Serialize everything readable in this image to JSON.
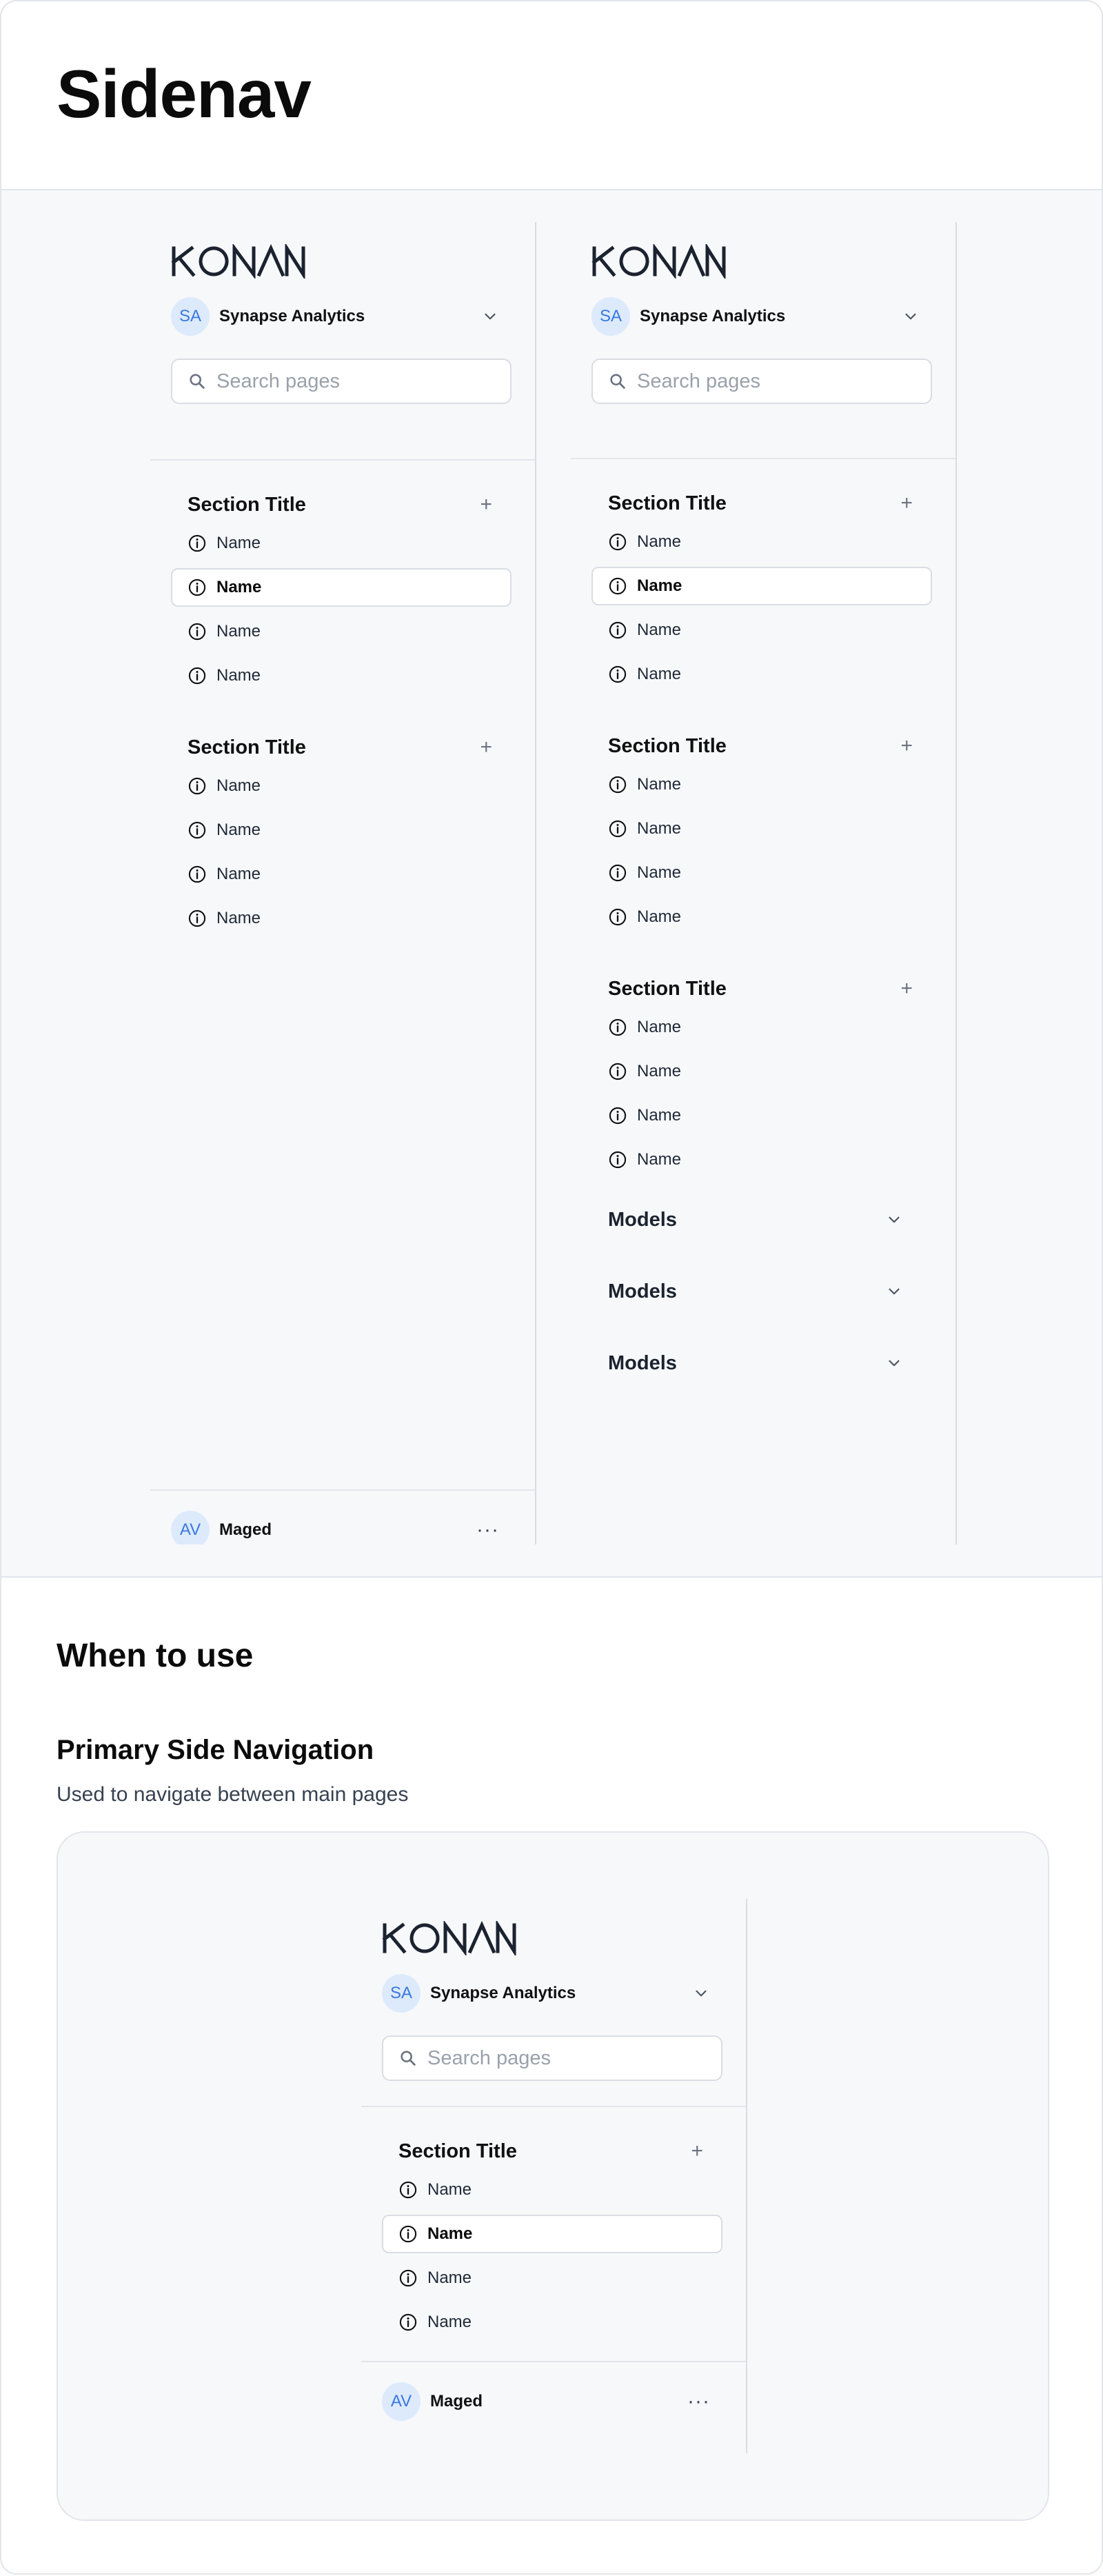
{
  "page": {
    "title": "Sidenav"
  },
  "brand": {
    "logo_text": "KONAN",
    "logo_color": "#1b2330"
  },
  "workspace": {
    "initials": "SA",
    "name": "Synapse Analytics",
    "avatar_bg": "#dceafc",
    "avatar_fg": "#3a78e0"
  },
  "search": {
    "placeholder": "Search pages"
  },
  "user": {
    "initials": "AV",
    "name": "Maged",
    "menu_glyph": "···"
  },
  "sidenav_collapsed": {
    "sections": [
      {
        "title": "Section Title",
        "add_glyph": "+",
        "items": [
          {
            "label": "Name",
            "active": false
          },
          {
            "label": "Name",
            "active": true
          },
          {
            "label": "Name",
            "active": false
          },
          {
            "label": "Name",
            "active": false
          }
        ]
      },
      {
        "title": "Section Title",
        "add_glyph": "+",
        "items": [
          {
            "label": "Name",
            "active": false
          },
          {
            "label": "Name",
            "active": false
          },
          {
            "label": "Name",
            "active": false
          },
          {
            "label": "Name",
            "active": false
          }
        ]
      }
    ]
  },
  "sidenav_expanded": {
    "sections": [
      {
        "title": "Section Title",
        "add_glyph": "+",
        "items": [
          {
            "label": "Name",
            "active": false
          },
          {
            "label": "Name",
            "active": true
          },
          {
            "label": "Name",
            "active": false
          },
          {
            "label": "Name",
            "active": false
          }
        ]
      },
      {
        "title": "Section Title",
        "add_glyph": "+",
        "items": [
          {
            "label": "Name",
            "active": false
          },
          {
            "label": "Name",
            "active": false
          },
          {
            "label": "Name",
            "active": false
          },
          {
            "label": "Name",
            "active": false
          }
        ]
      },
      {
        "title": "Section Title",
        "add_glyph": "+",
        "items": [
          {
            "label": "Name",
            "active": false
          },
          {
            "label": "Name",
            "active": false
          },
          {
            "label": "Name",
            "active": false
          },
          {
            "label": "Name",
            "active": false
          }
        ]
      }
    ],
    "groups": [
      {
        "label": "Models"
      },
      {
        "label": "Models"
      },
      {
        "label": "Models"
      }
    ]
  },
  "when_to_use": {
    "heading": "When to use",
    "primary": {
      "title": "Primary Side Navigation",
      "description": "Used to navigate between main pages",
      "section": {
        "title": "Section Title",
        "add_glyph": "+",
        "items": [
          {
            "label": "Name",
            "active": false
          },
          {
            "label": "Name",
            "active": true
          },
          {
            "label": "Name",
            "active": false
          },
          {
            "label": "Name",
            "active": false
          }
        ]
      }
    }
  },
  "icons": {
    "item_icon": "info-circle-icon",
    "search_icon": "magnifier-icon",
    "chevron_icon": "chevron-down-icon"
  }
}
